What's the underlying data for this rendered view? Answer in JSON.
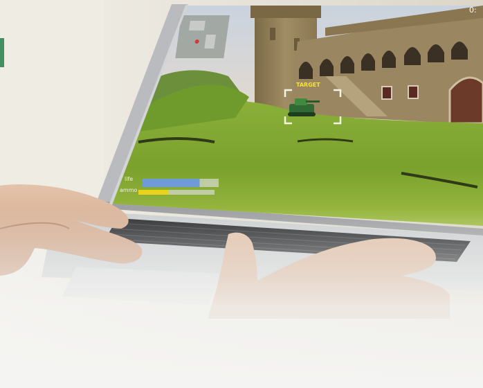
{
  "photo": {
    "subject": "hands-on-laptop-playing-tank-game"
  },
  "game_hud": {
    "life_label": "life",
    "ammo_label": "ammo",
    "life_level": 0.75,
    "ammo_level": 0.4,
    "target_label": "TARGET",
    "timer_text": "0:",
    "colors": {
      "life_bar": "#6f9bd8",
      "ammo_bar": "#e8d21a",
      "bar_track": "#c9d2b8",
      "target_box": "#f3f3e6",
      "target_text": "#f7e23a"
    }
  },
  "colors": {
    "grass": "#7aa12c",
    "sky": "#e8dccb",
    "castle_stone": "#8b7a55",
    "laptop_body": "#c9cacc",
    "keyboard": "#2a2b2e",
    "accent_left_tab": "#3f8f62"
  }
}
